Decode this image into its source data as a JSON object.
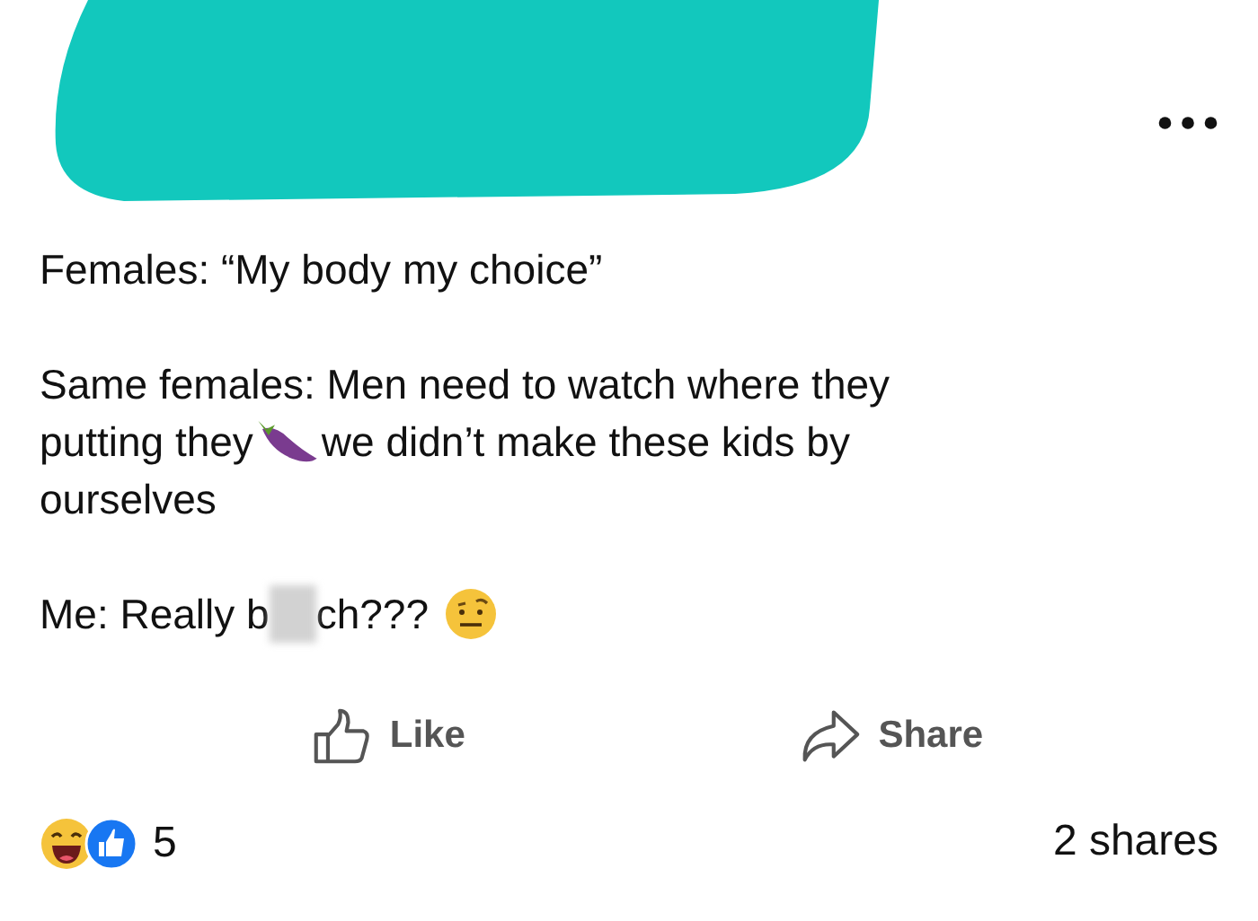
{
  "header": {
    "redacted": true
  },
  "post": {
    "line_1": "Females: “My body my choice”",
    "line_2": {
      "first": "Same females: Men need to watch where they",
      "before": "putting they",
      "after": "we didn’t make these kids by",
      "last": "ourselves"
    },
    "line_3": {
      "before": "Me: Really b",
      "after": "ch???"
    }
  },
  "actions": [
    {
      "kind": "like",
      "label": "Like"
    },
    {
      "kind": "share",
      "label": "Share"
    }
  ],
  "footer": {
    "reaction_count": "5",
    "shares": "2 shares"
  }
}
